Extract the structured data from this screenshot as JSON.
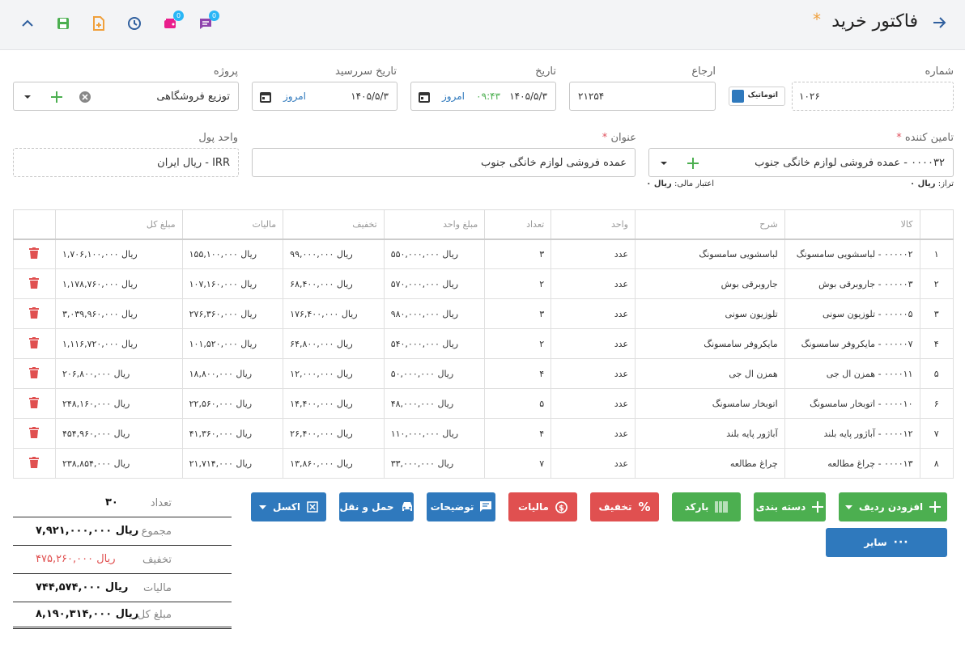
{
  "header": {
    "title": "فاکتور خرید",
    "star": "*",
    "badges": {
      "chat": "0",
      "wallet": "0"
    }
  },
  "form": {
    "number": {
      "label": "شماره",
      "value": "۱۰۲۶",
      "auto_label": "اتوماتیک"
    },
    "reference": {
      "label": "ارجاع",
      "value": "۲۱۲۵۴"
    },
    "date": {
      "label": "تاریخ",
      "value": "۱۴۰۵/۵/۳",
      "time": "۰۹:۴۳",
      "today": "امروز"
    },
    "due_date": {
      "label": "تاریخ سررسید",
      "value": "۱۴۰۵/۵/۳",
      "today": "امروز"
    },
    "project": {
      "label": "پروژه",
      "value": "توزیع فروشگاهی"
    },
    "supplier": {
      "label": "تامین کننده",
      "value": "۰۰۰۰۳۲ - عمده فروشی لوازم خانگی جنوب",
      "balance_label": "تراز:",
      "balance_value": "ریال ۰",
      "credit_label": "اعتبار مالی:",
      "credit_value": "ریال ۰"
    },
    "subject": {
      "label": "عنوان",
      "value": "عمده فروشی لوازم خانگی جنوب"
    },
    "currency": {
      "label": "واحد پول",
      "value": "IRR - ریال ایران"
    }
  },
  "table": {
    "headers": [
      "کالا",
      "شرح",
      "واحد",
      "تعداد",
      "مبلغ واحد",
      "تخفیف",
      "مالیات",
      "مبلغ کل"
    ],
    "rows": [
      {
        "idx": "۱",
        "item": "۰۰۰۰۰۲ - لباسشویی سامسونگ",
        "desc": "لباسشویی سامسونگ",
        "unit": "عدد",
        "qty": "۳",
        "price": "ریال ۵۵۰,۰۰۰,۰۰۰",
        "disc": "ریال ۹۹,۰۰۰,۰۰۰",
        "tax": "ریال ۱۵۵,۱۰۰,۰۰۰",
        "total": "ریال ۱,۷۰۶,۱۰۰,۰۰۰"
      },
      {
        "idx": "۲",
        "item": "۰۰۰۰۰۳ - جاروبرقی بوش",
        "desc": "جاروبرقی بوش",
        "unit": "عدد",
        "qty": "۲",
        "price": "ریال ۵۷۰,۰۰۰,۰۰۰",
        "disc": "ریال ۶۸,۴۰۰,۰۰۰",
        "tax": "ریال ۱۰۷,۱۶۰,۰۰۰",
        "total": "ریال ۱,۱۷۸,۷۶۰,۰۰۰"
      },
      {
        "idx": "۳",
        "item": "۰۰۰۰۰۵ - تلوزیون سونی",
        "desc": "تلوزیون سونی",
        "unit": "عدد",
        "qty": "۳",
        "price": "ریال ۹۸۰,۰۰۰,۰۰۰",
        "disc": "ریال ۱۷۶,۴۰۰,۰۰۰",
        "tax": "ریال ۲۷۶,۳۶۰,۰۰۰",
        "total": "ریال ۳,۰۳۹,۹۶۰,۰۰۰"
      },
      {
        "idx": "۴",
        "item": "۰۰۰۰۰۷ - مایکروفر سامسونگ",
        "desc": "مایکروفر سامسونگ",
        "unit": "عدد",
        "qty": "۲",
        "price": "ریال ۵۴۰,۰۰۰,۰۰۰",
        "disc": "ریال ۶۴,۸۰۰,۰۰۰",
        "tax": "ریال ۱۰۱,۵۲۰,۰۰۰",
        "total": "ریال ۱,۱۱۶,۷۲۰,۰۰۰"
      },
      {
        "idx": "۵",
        "item": "۰۰۰۰۱۱ - همزن ال جی",
        "desc": "همزن ال جی",
        "unit": "عدد",
        "qty": "۴",
        "price": "ریال ۵۰,۰۰۰,۰۰۰",
        "disc": "ریال ۱۲,۰۰۰,۰۰۰",
        "tax": "ریال ۱۸,۸۰۰,۰۰۰",
        "total": "ریال ۲۰۶,۸۰۰,۰۰۰"
      },
      {
        "idx": "۶",
        "item": "۰۰۰۰۱۰ - اتوبخار سامسونگ",
        "desc": "اتوبخار سامسونگ",
        "unit": "عدد",
        "qty": "۵",
        "price": "ریال ۴۸,۰۰۰,۰۰۰",
        "disc": "ریال ۱۴,۴۰۰,۰۰۰",
        "tax": "ریال ۲۲,۵۶۰,۰۰۰",
        "total": "ریال ۲۴۸,۱۶۰,۰۰۰"
      },
      {
        "idx": "۷",
        "item": "۰۰۰۰۱۲ - آباژور پایه بلند",
        "desc": "آباژور پایه بلند",
        "unit": "عدد",
        "qty": "۴",
        "price": "ریال ۱۱۰,۰۰۰,۰۰۰",
        "disc": "ریال ۲۶,۴۰۰,۰۰۰",
        "tax": "ریال ۴۱,۳۶۰,۰۰۰",
        "total": "ریال ۴۵۴,۹۶۰,۰۰۰"
      },
      {
        "idx": "۸",
        "item": "۰۰۰۰۱۳ - چراغ مطالعه",
        "desc": "چراغ مطالعه",
        "unit": "عدد",
        "qty": "۷",
        "price": "ریال ۳۳,۰۰۰,۰۰۰",
        "disc": "ریال ۱۳,۸۶۰,۰۰۰",
        "tax": "ریال ۲۱,۷۱۴,۰۰۰",
        "total": "ریال ۲۳۸,۸۵۴,۰۰۰"
      }
    ]
  },
  "buttons": {
    "add_row": "افزودن ردیف",
    "category": "دسته بندی",
    "barcode": "بارکد",
    "discount": "تخفیف",
    "tax": "مالیات",
    "notes": "توضیحات",
    "shipping": "حمل و نقل",
    "excel": "اکسل",
    "other": "سایر"
  },
  "summary": {
    "count_label": "تعداد",
    "count": "۳۰",
    "sum_label": "مجموع",
    "sum": "ریال ۷,۹۲۱,۰۰۰,۰۰۰",
    "discount_label": "تخفیف",
    "discount": "ریال ۴۷۵,۲۶۰,۰۰۰",
    "tax_label": "مالیات",
    "tax": "ریال ۷۴۴,۵۷۴,۰۰۰",
    "total_label": "مبلغ کل",
    "total": "ریال ۸,۱۹۰,۳۱۴,۰۰۰"
  },
  "colors": {
    "accent": "#2f79bd",
    "green": "#4caf50",
    "red": "#e05050",
    "star": "#f0a03c",
    "badge": "#29b6f6"
  }
}
